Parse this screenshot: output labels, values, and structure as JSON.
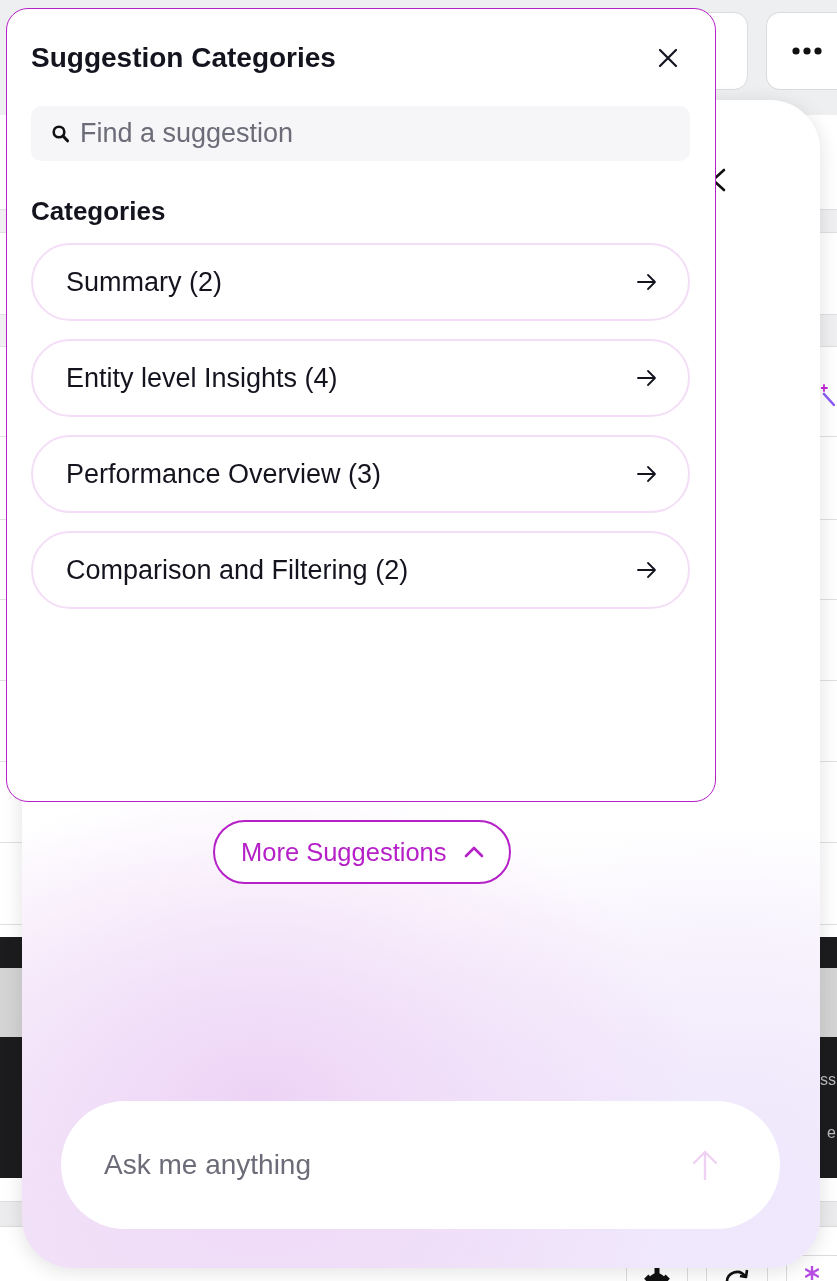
{
  "suggestion_popup": {
    "title": "Suggestion Categories",
    "search": {
      "placeholder": "Find a suggestion"
    },
    "heading": "Categories",
    "categories": [
      {
        "label": "Summary (2)"
      },
      {
        "label": "Entity level Insights (4)"
      },
      {
        "label": "Performance Overview (3)"
      },
      {
        "label": "Comparison and Filtering (2)"
      }
    ]
  },
  "assistant_panel": {
    "more_suggestions": {
      "label": "More Suggestions",
      "expanded": true
    },
    "input": {
      "placeholder": "Ask me anything"
    }
  },
  "dark_card": {
    "lines": [
      "ss",
      "e"
    ]
  }
}
